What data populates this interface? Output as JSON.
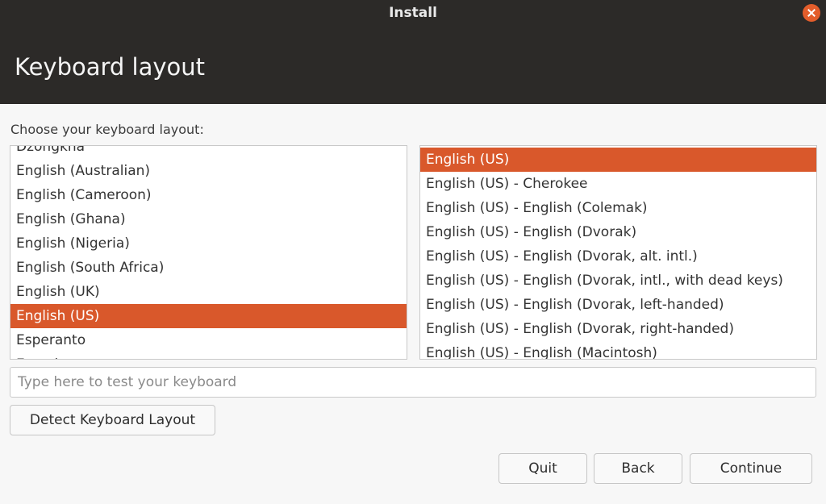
{
  "window": {
    "title": "Install"
  },
  "header": {
    "title": "Keyboard layout"
  },
  "prompt": "Choose your keyboard layout:",
  "layouts": [
    "Dzongkha",
    "English (Australian)",
    "English (Cameroon)",
    "English (Ghana)",
    "English (Nigeria)",
    "English (South Africa)",
    "English (UK)",
    "English (US)",
    "Esperanto",
    "Estonian"
  ],
  "selected_layout": "English (US)",
  "variants": [
    "English (US)",
    "English (US) - Cherokee",
    "English (US) - English (Colemak)",
    "English (US) - English (Dvorak)",
    "English (US) - English (Dvorak, alt. intl.)",
    "English (US) - English (Dvorak, intl., with dead keys)",
    "English (US) - English (Dvorak, left-handed)",
    "English (US) - English (Dvorak, right-handed)",
    "English (US) - English (Macintosh)"
  ],
  "selected_variant": "English (US)",
  "test_input": {
    "value": "",
    "placeholder": "Type here to test your keyboard"
  },
  "buttons": {
    "detect": "Detect Keyboard Layout",
    "quit": "Quit",
    "back": "Back",
    "continue": "Continue"
  },
  "colors": {
    "accent": "#d9582b",
    "header_bg": "#2c2a28",
    "close": "#e35d2b"
  }
}
